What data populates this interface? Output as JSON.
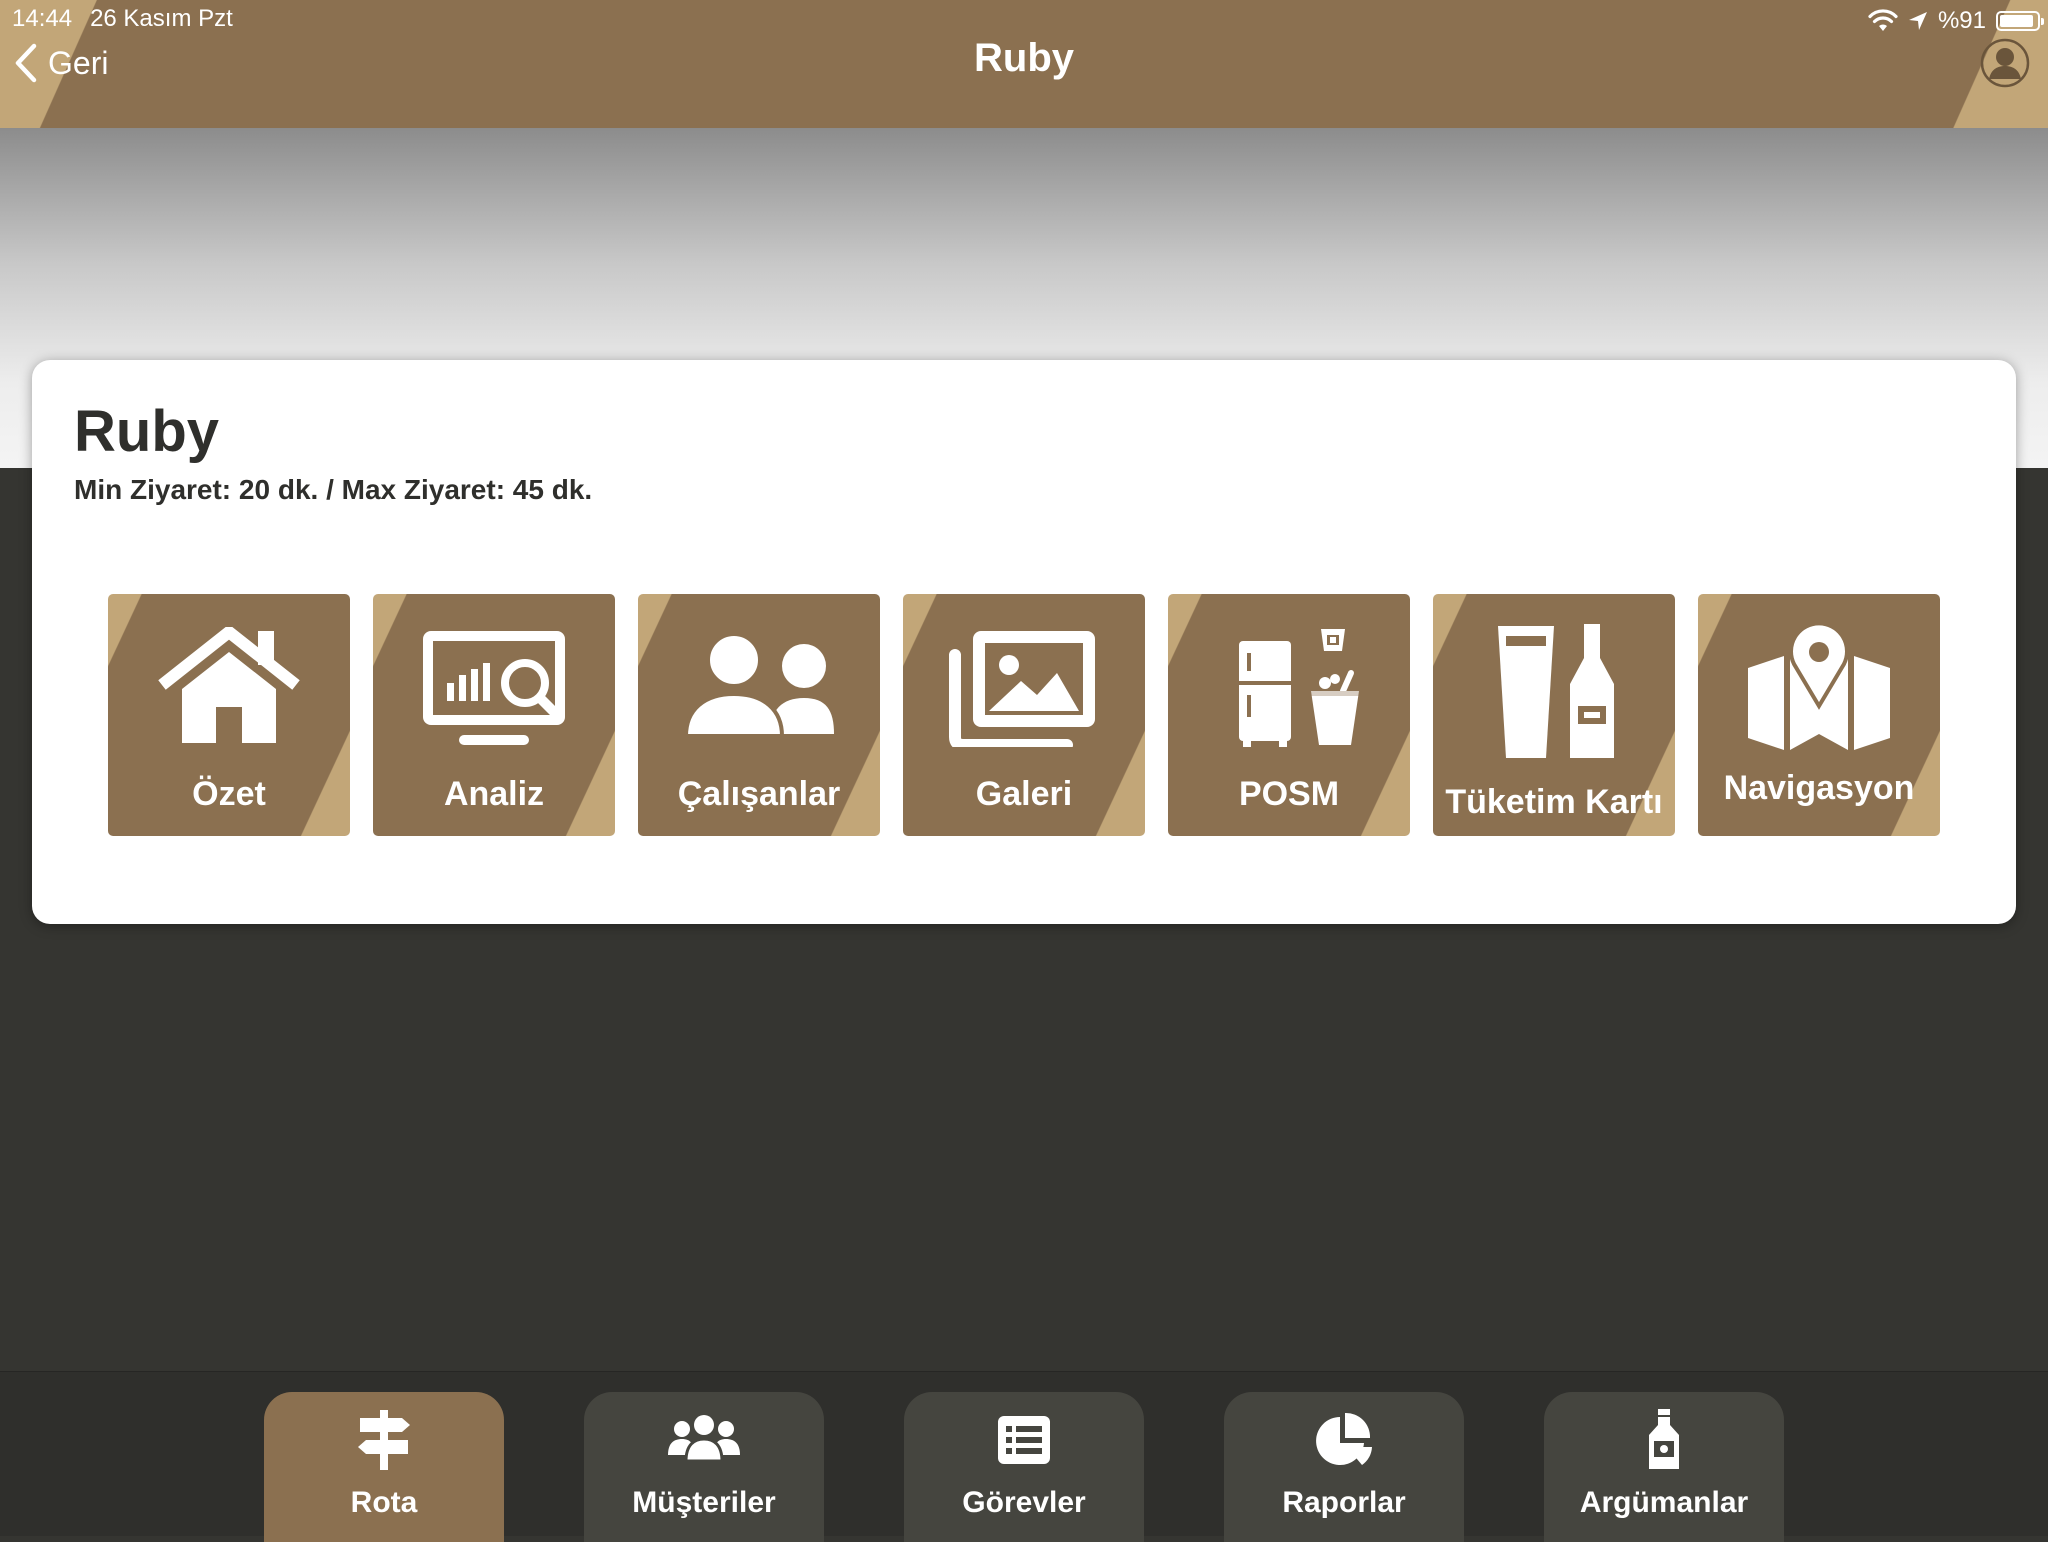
{
  "status_bar": {
    "time": "14:44",
    "date": "26 Kasım Pzt",
    "battery": "%91",
    "battery_level": 0.91
  },
  "navbar": {
    "back_label": "Geri",
    "title": "Ruby"
  },
  "store": {
    "name": "Ruby",
    "visit_info": "Min Ziyaret: 20 dk. / Max Ziyaret: 45 dk."
  },
  "tiles": [
    {
      "label": "Özet",
      "icon": "house-icon"
    },
    {
      "label": "Analiz",
      "icon": "analysis-monitor-icon"
    },
    {
      "label": "Çalışanlar",
      "icon": "users-icon"
    },
    {
      "label": "Galeri",
      "icon": "gallery-icon"
    },
    {
      "label": "POSM",
      "icon": "fridge-ice-bucket-icon"
    },
    {
      "label": "Tüketim Kartı",
      "icon": "glass-bottle-icon"
    },
    {
      "label": "Navigasyon",
      "icon": "map-pin-icon"
    }
  ],
  "tabbar": [
    {
      "label": "Rota",
      "icon": "signpost-icon",
      "active": true
    },
    {
      "label": "Müşteriler",
      "icon": "group-icon",
      "active": false
    },
    {
      "label": "Görevler",
      "icon": "task-list-icon",
      "active": false
    },
    {
      "label": "Raporlar",
      "icon": "pie-chart-icon",
      "active": false
    },
    {
      "label": "Argümanlar",
      "icon": "bottle-icon",
      "active": false
    }
  ],
  "colors": {
    "brand": "#8b7050",
    "brand_light": "#c2a678",
    "background_dark": "#353531",
    "tab_inactive": "#45453f"
  }
}
